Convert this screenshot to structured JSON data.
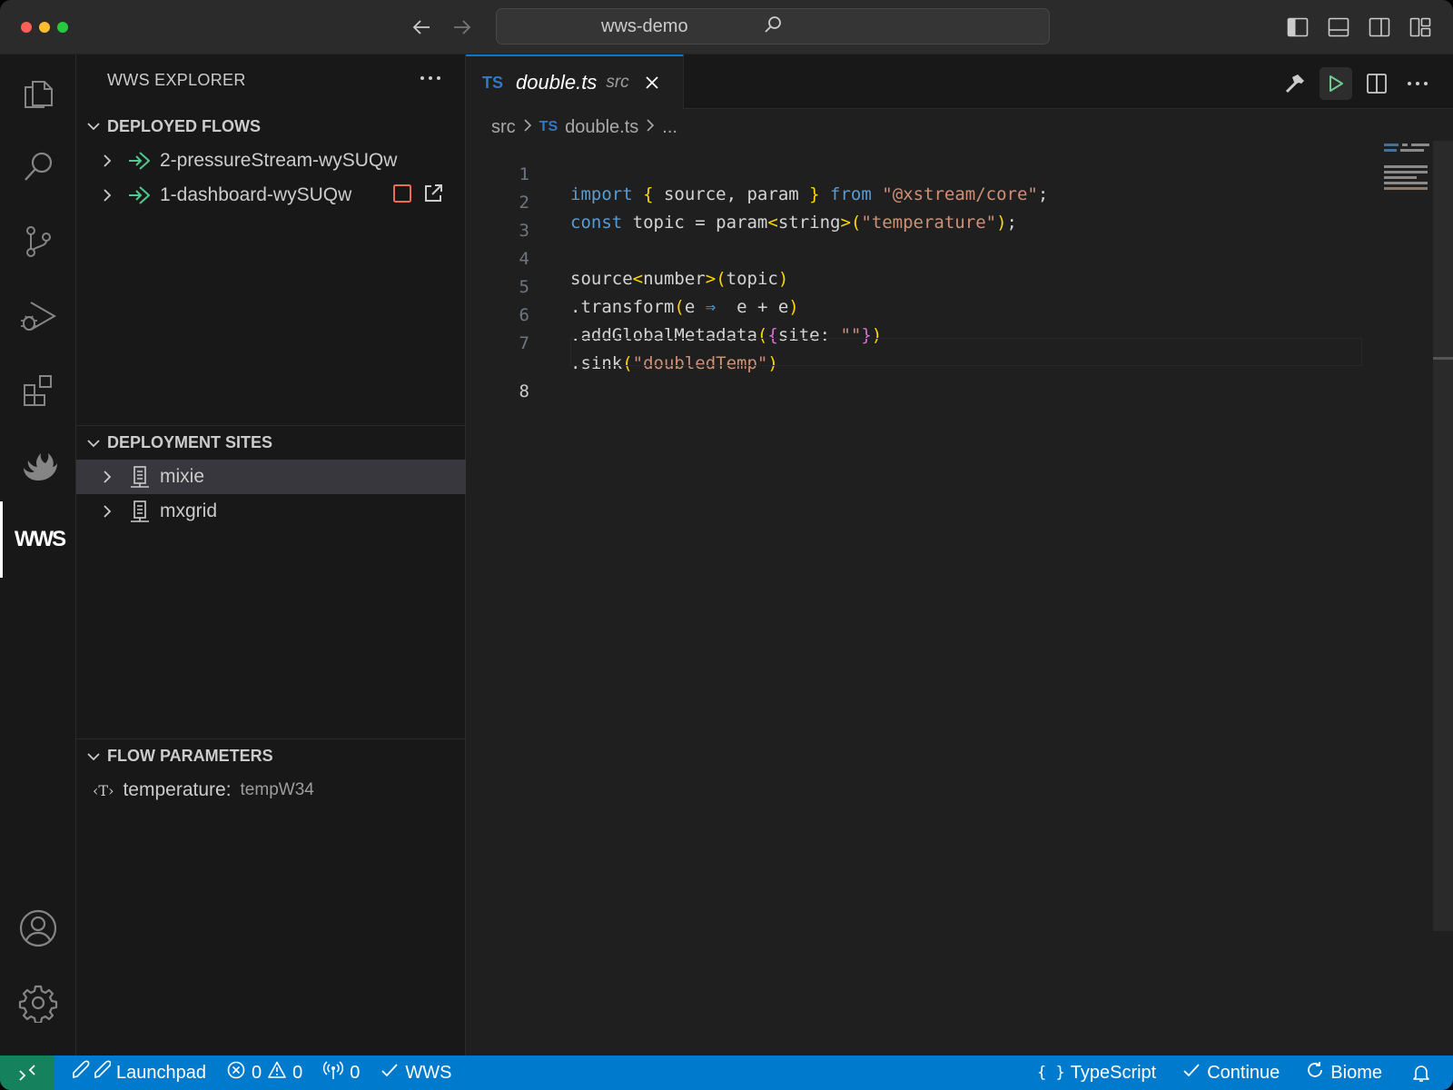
{
  "titlebar": {
    "search_text": "wws-demo"
  },
  "sidebar": {
    "title": "WWS EXPLORER",
    "sections": {
      "deployed_flows": {
        "label": "DEPLOYED FLOWS",
        "items": [
          {
            "label": "2-pressureStream-wySUQw"
          },
          {
            "label": "1-dashboard-wySUQw"
          }
        ]
      },
      "deployment_sites": {
        "label": "DEPLOYMENT SITES",
        "items": [
          {
            "label": "mixie"
          },
          {
            "label": "mxgrid"
          }
        ]
      },
      "flow_parameters": {
        "label": "FLOW PARAMETERS",
        "items": [
          {
            "type_icon": "‹T›",
            "name": "temperature:",
            "value": "tempW34"
          }
        ]
      }
    }
  },
  "editor": {
    "tab": {
      "lang_badge": "TS",
      "filename": "double.ts",
      "description": "src"
    },
    "breadcrumb": {
      "folder": "src",
      "lang_badge": "TS",
      "file": "double.ts",
      "ellipsis": "..."
    },
    "line_numbers": [
      "1",
      "2",
      "3",
      "4",
      "5",
      "6",
      "7",
      "8"
    ],
    "current_line": 8
  },
  "statusbar": {
    "launchpad": "Launchpad",
    "errors": "0",
    "warnings": "0",
    "ports": "0",
    "wws": "WWS",
    "language": "TypeScript",
    "continue": "Continue",
    "biome": "Biome"
  },
  "colors": {
    "accent": "#007acc",
    "remote": "#16825d",
    "flow_icon": "#4ec990",
    "stop_icon": "#f06c4f",
    "ts_badge": "#3178c6"
  }
}
